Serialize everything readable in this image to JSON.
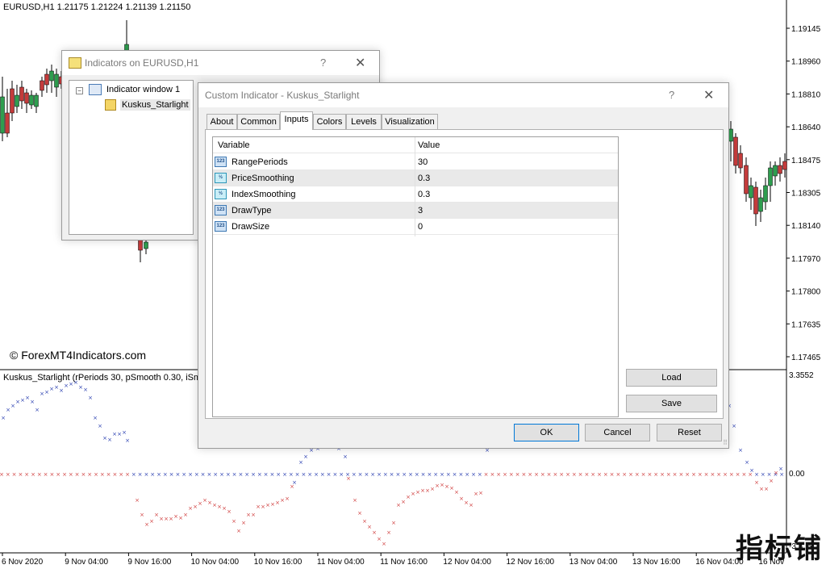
{
  "chart": {
    "title": "EURUSD,H1  1.21175 1.21224 1.21139 1.21150",
    "watermark": "© ForexMT4Indicators.com",
    "subwindow_title": "Kuskus_Starlight  (rPeriods 30, pSmooth 0.30, iSmoot",
    "price_axis": [
      "1.19145",
      "1.18960",
      "1.18810",
      "1.18640",
      "1.18475",
      "1.18305",
      "1.18140",
      "1.17970",
      "1.17800",
      "1.17635",
      "1.17465"
    ],
    "sub_axis": [
      "3.3552",
      "0.00",
      "-3.3..5"
    ],
    "time_axis": [
      "6 Nov 2020",
      "9 Nov 04:00",
      "9 Nov 16:00",
      "10 Nov 04:00",
      "10 Nov 16:00",
      "11 Nov 04:00",
      "11 Nov 16:00",
      "12 Nov 04:00",
      "12 Nov 16:00",
      "13 Nov 04:00",
      "13 Nov 16:00",
      "16 Nov 04:00",
      "16 Nov"
    ],
    "corner_logo": "指标铺",
    "colors": {
      "bull": "#2e9e4f",
      "bear": "#c43b3b",
      "blue_marker": "#2a3fb0",
      "red_marker": "#d04040"
    }
  },
  "indicators_dialog": {
    "title": "Indicators on EURUSD,H1",
    "help": "?",
    "close": "✕",
    "tree": {
      "root": "Indicator window 1",
      "child": "Kuskus_Starlight"
    }
  },
  "custom_dialog": {
    "title": "Custom Indicator - Kuskus_Starlight",
    "help": "?",
    "close": "✕",
    "tabs": [
      "About",
      "Common",
      "Inputs",
      "Colors",
      "Levels",
      "Visualization"
    ],
    "active_tab": "Inputs",
    "grid": {
      "headers": [
        "Variable",
        "Value"
      ],
      "rows": [
        {
          "icon": "123",
          "name": "RangePeriods",
          "value": "30"
        },
        {
          "icon": "½",
          "name": "PriceSmoothing",
          "value": "0.3"
        },
        {
          "icon": "½",
          "name": "IndexSmoothing",
          "value": "0.3"
        },
        {
          "icon": "123",
          "name": "DrawType",
          "value": "3"
        },
        {
          "icon": "123",
          "name": "DrawSize",
          "value": "0"
        }
      ]
    },
    "buttons": {
      "load": "Load",
      "save": "Save",
      "ok": "OK",
      "cancel": "Cancel",
      "reset": "Reset"
    }
  }
}
